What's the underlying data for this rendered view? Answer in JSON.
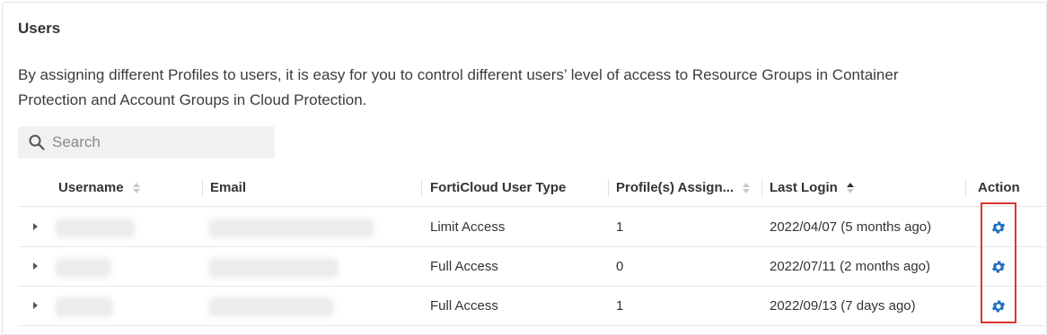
{
  "section": {
    "title": "Users",
    "description": "By assigning different Profiles to users, it is easy for you to control different users’ level of access to Resource Groups in Container Protection and Account Groups in Cloud Protection."
  },
  "search": {
    "placeholder": "Search",
    "value": ""
  },
  "table": {
    "columns": {
      "username": "Username",
      "email": "Email",
      "user_type": "FortiCloud User Type",
      "profiles": "Profile(s) Assign...",
      "last_login": "Last Login",
      "action": "Action"
    },
    "rows": [
      {
        "user_type": "Limit Access",
        "profiles": "1",
        "last_login": "2022/04/07 (5 months ago)",
        "action_icon": "gear-icon"
      },
      {
        "user_type": "Full Access",
        "profiles": "0",
        "last_login": "2022/07/11 (2 months ago)",
        "action_icon": "gear-icon"
      },
      {
        "user_type": "Full Access",
        "profiles": "1",
        "last_login": "2022/09/13 (7 days ago)",
        "action_icon": "gear-icon"
      }
    ]
  },
  "colors": {
    "accent": "#1f6fc0",
    "highlight": "#e0322f"
  }
}
